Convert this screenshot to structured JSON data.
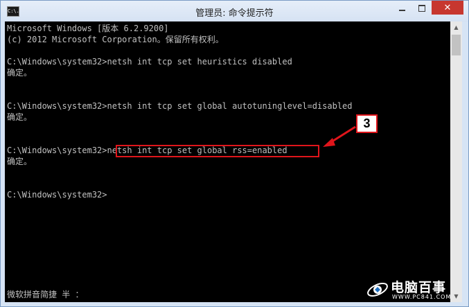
{
  "window": {
    "title": "管理员: 命令提示符",
    "icon_text": "C:\\.",
    "controls": {
      "minimize": "minimize-icon",
      "maximize": "maximize-icon",
      "close": "close-icon"
    }
  },
  "console": {
    "lines": [
      "Microsoft Windows [版本 6.2.9200]",
      "(c) 2012 Microsoft Corporation。保留所有权利。",
      "",
      "C:\\Windows\\system32>netsh int tcp set heuristics disabled",
      "确定。",
      "",
      "",
      "C:\\Windows\\system32>netsh int tcp set global autotuninglevel=disabled",
      "确定。",
      "",
      "",
      "C:\\Windows\\system32>netsh int tcp set global rss=enabled",
      "确定。",
      "",
      "",
      "C:\\Windows\\system32>"
    ],
    "ime_status": "微软拼音简捷 半 ："
  },
  "annotation": {
    "badge": "3",
    "color": "#e0151b"
  },
  "watermark": {
    "text": "电脑百事",
    "url": "WWW.PC841.COM"
  }
}
